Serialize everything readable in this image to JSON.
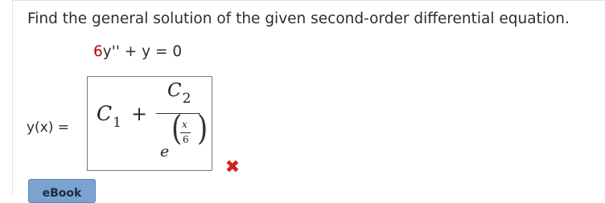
{
  "question": {
    "text": "Find the general solution of the given second-order differential equation.",
    "equation": {
      "coefficient": "6",
      "rest": "y'' + y = 0"
    }
  },
  "answer": {
    "label": "y(x) =",
    "c1_letter": "C",
    "c1_sub": "1",
    "plus": "+",
    "c2_letter": "C",
    "c2_sub": "2",
    "exp_base": "e",
    "exp_num": "x",
    "exp_den": "6",
    "lparen": "(",
    "rparen": ")",
    "status_icon": "incorrect-x-icon",
    "status_glyph": "✖",
    "status_color": "#d02020"
  },
  "ebook": {
    "label": "eBook"
  }
}
